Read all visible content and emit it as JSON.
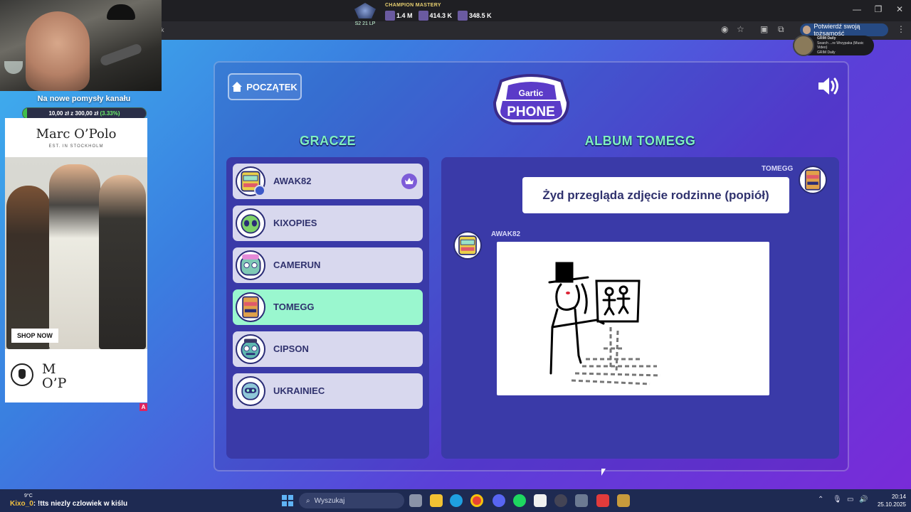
{
  "browser": {
    "addr_fragment": "k",
    "verify_label": "Potwierdź swoją tożsamość",
    "ext_popup": {
      "title": "GRIM Daily",
      "line1": "Search ...re Wrzypaka (Music Video)",
      "line2": "GRIM Daily"
    }
  },
  "lol_overlay": {
    "rank_text": "S2 21 LP",
    "title": "CHAMPION MASTERY",
    "values": [
      "1.4 M",
      "414.3 K",
      "348.5 K"
    ]
  },
  "stream": {
    "goal_title": "Na nowe pomysły kanału",
    "goal_amount": "10,00 zł z 300,00 zł",
    "goal_percent_text": "(3.33%)",
    "goal_fraction": 0.0333,
    "chat_user": "Kixo_0",
    "chat_message": ": !tts niezly czlowiek w kiślu",
    "weather": "9°C"
  },
  "ad": {
    "brand": "Marc O’Polo",
    "tagline": "EST. IN STOCKHOLM",
    "cta": "SHOP NOW",
    "logo_line1": "M",
    "logo_line2": "O’P",
    "flag": "A"
  },
  "game": {
    "home_label": "POCZĄTEK",
    "logo_line1": "Gartic",
    "logo_line2": "PHONE",
    "players_title": "GRACZE",
    "album_title": "ALBUM TOMEGG",
    "players": [
      {
        "name": "AWAK82",
        "host": true,
        "active": false
      },
      {
        "name": "KIXOPIES",
        "host": false,
        "active": false
      },
      {
        "name": "CAMERUN",
        "host": false,
        "active": false
      },
      {
        "name": "TOMEGG",
        "host": false,
        "active": true
      },
      {
        "name": "CIPSON",
        "host": false,
        "active": false
      },
      {
        "name": "UKRAINIEC",
        "host": false,
        "active": false
      }
    ],
    "album": {
      "prompt_author": "TOMEGG",
      "prompt_text": "Żyd przegląda zdjęcie rodzinne (popiół)",
      "drawing_author": "AWAK82"
    }
  },
  "taskbar": {
    "search_placeholder": "Wyszukaj",
    "time": "20:14",
    "date": "25.10.2025"
  },
  "colors": {
    "accent_mint": "#9af7cf",
    "panel": "#3a3aa8",
    "title_mint": "#7ff0c0"
  }
}
